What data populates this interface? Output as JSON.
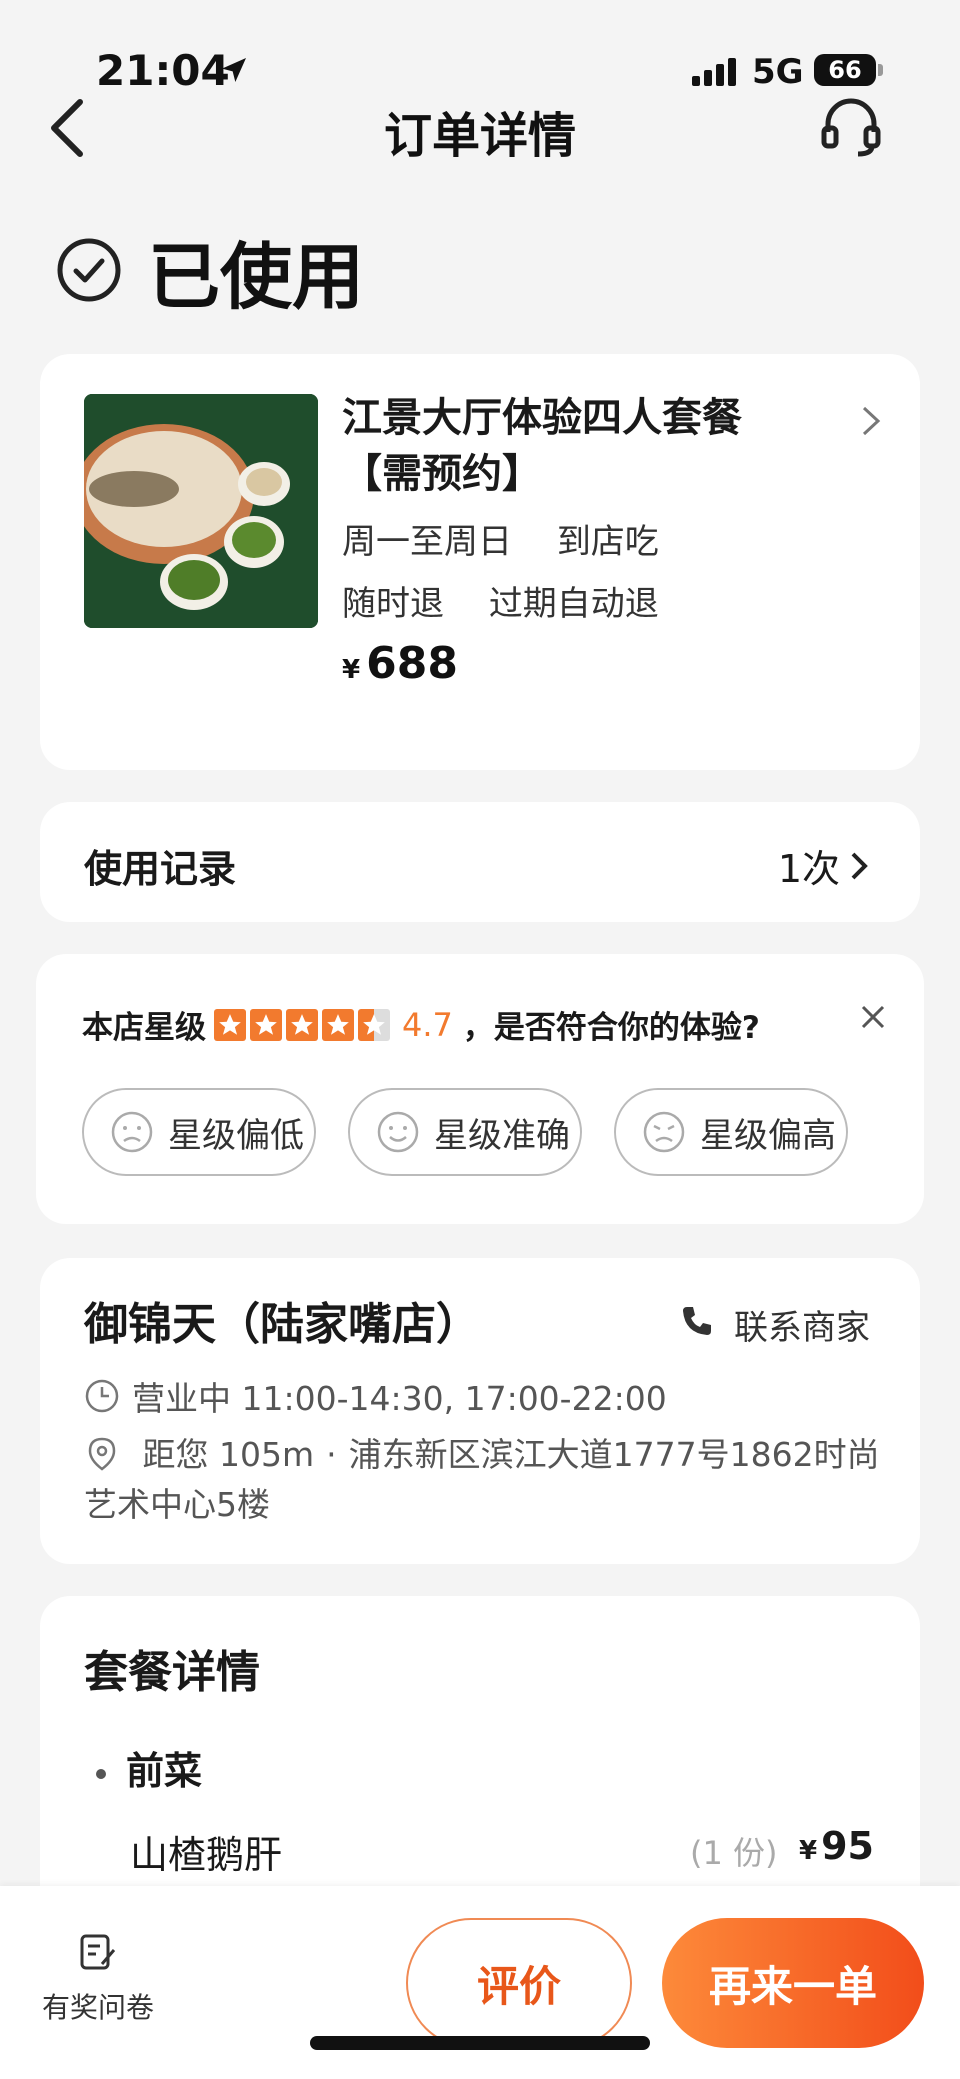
{
  "status_bar": {
    "time": "21:04",
    "network": "5G",
    "battery": "66"
  },
  "nav": {
    "title": "订单详情"
  },
  "order": {
    "status": "已使用"
  },
  "product": {
    "title": "江景大厅体验四人套餐【需预约】",
    "tags1": [
      "周一至周日",
      "到店吃"
    ],
    "tags2": [
      "随时退",
      "过期自动退"
    ],
    "price_symbol": "¥",
    "price": "688"
  },
  "usage": {
    "label": "使用记录",
    "count": "1次"
  },
  "rating": {
    "prefix": "本店星级",
    "value": "4.7",
    "question": "，是否符合你的体验?",
    "star_color": "#f27a2e",
    "stars": 4.7,
    "options": [
      "星级偏低",
      "星级准确",
      "星级偏高"
    ]
  },
  "shop": {
    "name": "御锦天（陆家嘴店）",
    "contact": "联系商家",
    "hours": "营业中 11:00-14:30, 17:00-22:00",
    "distance": "距您 105m",
    "address": "浦东新区滨江大道1777号1862时尚艺术中心5楼"
  },
  "package": {
    "title": "套餐详情",
    "section": "前菜",
    "items": [
      {
        "name": "山楂鹅肝",
        "qty": "(1 份)",
        "price_symbol": "¥",
        "price": "95"
      }
    ]
  },
  "bottom": {
    "survey": "有奖问卷",
    "review": "评价",
    "reorder": "再来一单",
    "accent": "#f24d1a"
  }
}
